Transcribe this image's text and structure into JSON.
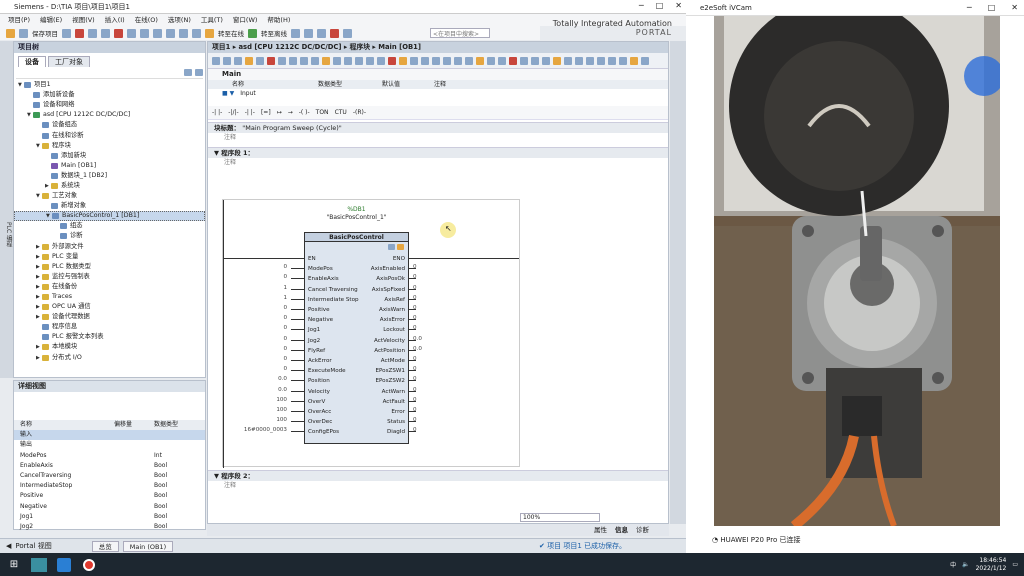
{
  "tia": {
    "title": "Siemens - D:\\TIA 项目\\项目1\\项目1",
    "menu": [
      "项目(P)",
      "编辑(E)",
      "视图(V)",
      "插入(I)",
      "在线(O)",
      "选项(N)",
      "工具(T)",
      "窗口(W)",
      "帮助(H)"
    ],
    "save_label": "保存项目",
    "go_online": "转至在线",
    "go_offline": "转至离线",
    "search_placeholder": "<在项目中搜索>",
    "brand_line1": "Totally Integrated Automation",
    "brand_line2": "PORTAL"
  },
  "tree": {
    "header": "项目树",
    "tab_devices": "设备",
    "tab_plant": "工厂对象",
    "side_label": "PLC 编程",
    "items": [
      {
        "label": "项目1",
        "indent": 0,
        "tw": "▼",
        "ico": ""
      },
      {
        "label": "添加新设备",
        "indent": 1,
        "tw": "",
        "ico": ""
      },
      {
        "label": "设备和网络",
        "indent": 1,
        "tw": "",
        "ico": ""
      },
      {
        "label": "asd [CPU 1212C DC/DC/DC]",
        "indent": 1,
        "tw": "▼",
        "ico": "g"
      },
      {
        "label": "设备组态",
        "indent": 2,
        "tw": "",
        "ico": ""
      },
      {
        "label": "在线和诊断",
        "indent": 2,
        "tw": "",
        "ico": ""
      },
      {
        "label": "程序块",
        "indent": 2,
        "tw": "▼",
        "ico": "y"
      },
      {
        "label": "添加新块",
        "indent": 3,
        "tw": "",
        "ico": ""
      },
      {
        "label": "Main [OB1]",
        "indent": 3,
        "tw": "",
        "ico": "p"
      },
      {
        "label": "数据块_1 [DB2]",
        "indent": 3,
        "tw": "",
        "ico": ""
      },
      {
        "label": "系统块",
        "indent": 3,
        "tw": "▶",
        "ico": "y"
      },
      {
        "label": "工艺对象",
        "indent": 2,
        "tw": "▼",
        "ico": "y"
      },
      {
        "label": "新增对象",
        "indent": 3,
        "tw": "",
        "ico": ""
      },
      {
        "label": "BasicPosControl_1 [DB1]",
        "indent": 3,
        "tw": "▼",
        "ico": "",
        "sel": true
      },
      {
        "label": "组态",
        "indent": 4,
        "tw": "",
        "ico": ""
      },
      {
        "label": "诊断",
        "indent": 4,
        "tw": "",
        "ico": ""
      },
      {
        "label": "外部源文件",
        "indent": 2,
        "tw": "▶",
        "ico": "y"
      },
      {
        "label": "PLC 变量",
        "indent": 2,
        "tw": "▶",
        "ico": "y"
      },
      {
        "label": "PLC 数据类型",
        "indent": 2,
        "tw": "▶",
        "ico": "y"
      },
      {
        "label": "监控与强制表",
        "indent": 2,
        "tw": "▶",
        "ico": "y"
      },
      {
        "label": "在线备份",
        "indent": 2,
        "tw": "▶",
        "ico": "y"
      },
      {
        "label": "Traces",
        "indent": 2,
        "tw": "▶",
        "ico": "y"
      },
      {
        "label": "OPC UA 通信",
        "indent": 2,
        "tw": "▶",
        "ico": "y"
      },
      {
        "label": "设备代理数据",
        "indent": 2,
        "tw": "▶",
        "ico": "y"
      },
      {
        "label": "程序信息",
        "indent": 2,
        "tw": "",
        "ico": ""
      },
      {
        "label": "PLC 报警文本列表",
        "indent": 2,
        "tw": "",
        "ico": ""
      },
      {
        "label": "本地模块",
        "indent": 2,
        "tw": "▶",
        "ico": "y"
      },
      {
        "label": "分布式 I/O",
        "indent": 2,
        "tw": "▶",
        "ico": "y"
      }
    ]
  },
  "detail": {
    "header": "详细视图",
    "col_name": "名称",
    "col_addr": "偏移量",
    "col_type": "数据类型",
    "rows": [
      {
        "n": "输入",
        "a": "",
        "t": ""
      },
      {
        "n": "输出",
        "a": "",
        "t": ""
      },
      {
        "n": "ModePos",
        "a": "",
        "t": "Int"
      },
      {
        "n": "EnableAxis",
        "a": "",
        "t": "Bool"
      },
      {
        "n": "CancelTraversing",
        "a": "",
        "t": "Bool"
      },
      {
        "n": "IntermediateStop",
        "a": "",
        "t": "Bool"
      },
      {
        "n": "Positive",
        "a": "",
        "t": "Bool"
      },
      {
        "n": "Negative",
        "a": "",
        "t": "Bool"
      },
      {
        "n": "Jog1",
        "a": "",
        "t": "Bool"
      },
      {
        "n": "Jog2",
        "a": "",
        "t": "Bool"
      }
    ]
  },
  "editor": {
    "breadcrumb": "项目1 ▸ asd [CPU 1212C DC/DC/DC] ▸ 程序块 ▸ Main [OB1]",
    "block_name": "Main",
    "if_cols": [
      "名称",
      "数据类型",
      "默认值",
      "注释"
    ],
    "if_row": "Input",
    "lad_tools": [
      "-| |-",
      "-|/|-",
      "-| |-",
      "[=]",
      "↦",
      "→",
      "-( )-",
      "TON",
      "CTU",
      "-(R)-"
    ],
    "block_title_label": "块标题：",
    "block_title_value": "\"Main Program Sweep (Cycle)\"",
    "block_comment": "注释",
    "seg1_label": "程序段 1：",
    "seg1_comment": "注释",
    "seg2_label": "程序段 2：",
    "seg2_comment": "注释",
    "zoom": "100%"
  },
  "fb": {
    "instance_db": "%DB1",
    "instance_name": "\"BasicPosControl_1\"",
    "title": "BasicPosControl",
    "left_pins": [
      "EN",
      "ModePos",
      "EnableAxis",
      "Cancel Traversing",
      "Intermediate Stop",
      "Positive",
      "Negative",
      "Jog1",
      "Jog2",
      "FlyRef",
      "AckError",
      "ExecuteMode",
      "Position",
      "Velocity",
      "OverV",
      "OverAcc",
      "OverDec",
      "ConfigEPos"
    ],
    "left_vals": [
      "",
      "0",
      "0",
      "1",
      "1",
      "0",
      "0",
      "0",
      "0",
      "0",
      "0",
      "0",
      "0.0",
      "0.0",
      "100",
      "100",
      "100",
      "16#0000_0003"
    ],
    "right_pins": [
      "ENO",
      "AxisEnabled",
      "AxisPosOk",
      "AxisSpFixed",
      "AxisRef",
      "AxisWarn",
      "AxisError",
      "Lockout",
      "ActVelocity",
      "ActPosition",
      "ActMode",
      "EPosZSW1",
      "EPosZSW2",
      "ActWarn",
      "ActFault",
      "Error",
      "Status",
      "DiagId"
    ],
    "right_vals": [
      "",
      "0",
      "0",
      "0",
      "0",
      "0",
      "0",
      "0",
      "0.0",
      "0.0",
      "0",
      "0",
      "0",
      "0",
      "0",
      "0",
      "0",
      "0"
    ]
  },
  "bottom": {
    "properties": "属性",
    "info": "信息",
    "diagnostics": "诊断",
    "portal_view": "Portal 视图",
    "overview": "总览",
    "main_tab": "Main (OB1)",
    "status_msg": "项目 项目1 已成功保存。"
  },
  "cam": {
    "title": "e2eSoft iVCam",
    "status": "HUAWEI P20 Pro 已连接"
  },
  "taskbar": {
    "time": "18:46:54",
    "date": "2022/1/12",
    "ime": "中"
  },
  "colors": {
    "tia_accent": "#c8d2de",
    "taskbar": "#1d2730",
    "selection": "#c6d7ec"
  }
}
